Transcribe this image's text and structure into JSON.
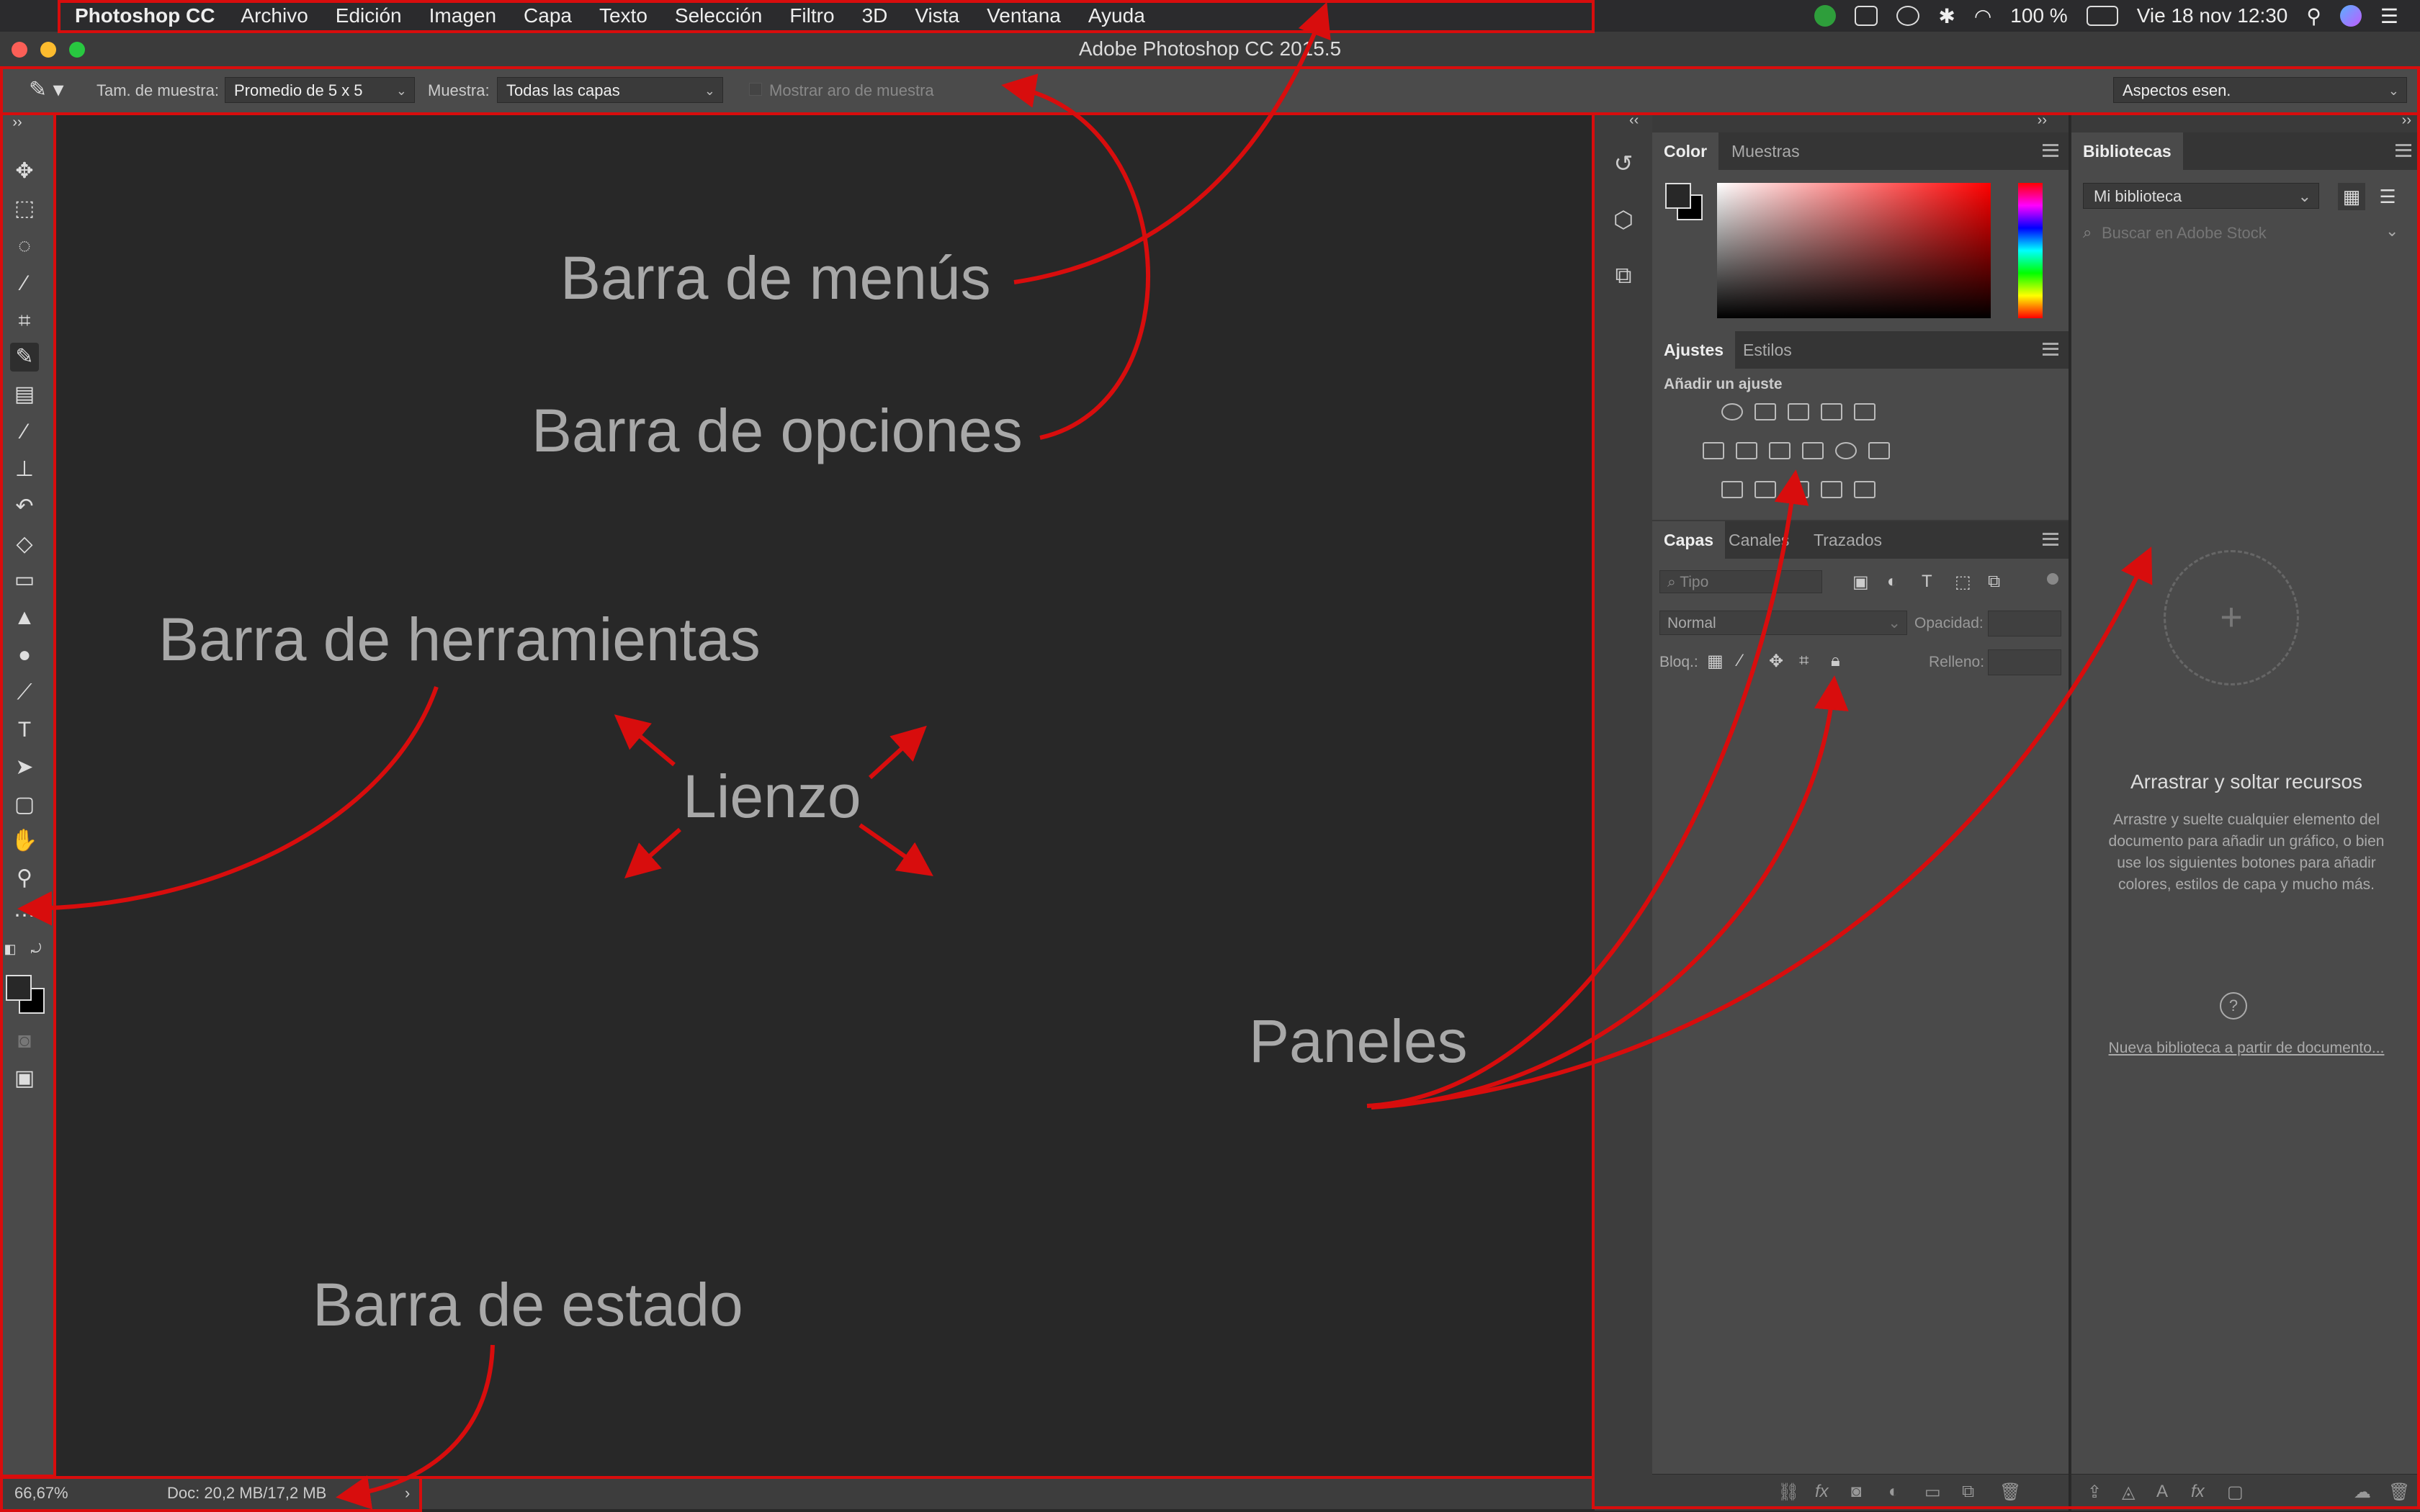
{
  "menubar": {
    "app_name": "Photoshop CC",
    "items": [
      "Archivo",
      "Edición",
      "Imagen",
      "Capa",
      "Texto",
      "Selección",
      "Filtro",
      "3D",
      "Vista",
      "Ventana",
      "Ayuda"
    ],
    "battery": "100 %",
    "datetime": "Vie 18 nov  12:30"
  },
  "titlebar": {
    "title": "Adobe Photoshop CC 2015.5"
  },
  "options": {
    "sample_size_label": "Tam. de muestra:",
    "sample_size_value": "Promedio de 5 x 5",
    "sample_label": "Muestra:",
    "sample_value": "Todas las capas",
    "show_ring_label": "Mostrar aro de muestra",
    "workspace_value": "Aspectos esen."
  },
  "status": {
    "zoom": "66,67%",
    "doc": "Doc: 20,2 MB/17,2 MB"
  },
  "panels": {
    "color_tabs": [
      "Color",
      "Muestras"
    ],
    "adjust_tabs": [
      "Ajustes",
      "Estilos"
    ],
    "adjust_heading": "Añadir un ajuste",
    "layers_tabs": [
      "Capas",
      "Canales",
      "Trazados"
    ],
    "layers_filter_placeholder": "Tipo",
    "blend_mode": "Normal",
    "opacity_label": "Opacidad:",
    "lock_label": "Bloq.:",
    "fill_label": "Relleno:"
  },
  "libraries": {
    "tab": "Bibliotecas",
    "library_select": "Mi biblioteca",
    "search_placeholder": "Buscar en Adobe Stock",
    "drop_title": "Arrastrar y soltar recursos",
    "drop_text": "Arrastre y suelte cualquier elemento del documento para añadir un gráfico, o bien use los siguientes botones para añadir colores, estilos de capa y mucho más.",
    "new_link": "Nueva biblioteca a partir de documento..."
  },
  "annotations": {
    "menu_bar": "Barra de menús",
    "options_bar": "Barra de opciones",
    "toolbar": "Barra de herramientas",
    "canvas": "Lienzo",
    "panels": "Paneles",
    "status_bar": "Barra de estado"
  },
  "colors": {
    "annotation_red": "#d80d0d",
    "ui_dark": "#282828",
    "panel_gray": "#4a4a4a"
  }
}
